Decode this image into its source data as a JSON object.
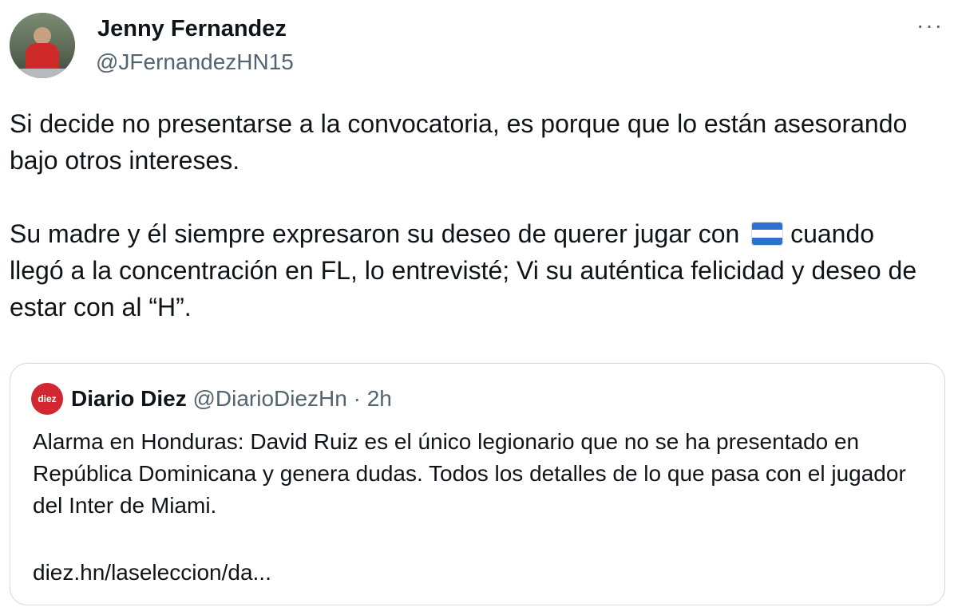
{
  "tweet": {
    "author": {
      "name": "Jenny Fernandez",
      "handle": "@JFernandezHN15"
    },
    "more_label": "···",
    "paragraphs": [
      "Si decide no presentarse a la convocatoria, es porque que lo están asesorando bajo otros intereses.",
      "Su madre y él siempre expresaron su deseo de querer jugar con",
      "cuando llegó a la concentración en FL, lo entrevisté; Vi su auténtica felicidad y deseo de estar con al “H”."
    ],
    "flag_icon": "honduras-flag-icon"
  },
  "quoted": {
    "avatar_text": "diez",
    "name": "Diario Diez",
    "meta": "@DiarioDiezHn · 2h",
    "text": "Alarma en Honduras: David Ruiz es el único legionario que no se ha presentado en República Dominicana y genera dudas. Todos los detalles de lo que pasa con el jugador del Inter de Miami.",
    "link": "diez.hn/laseleccion/da..."
  },
  "colors": {
    "text": "#0f1419",
    "secondary": "#536471",
    "border": "#cfd9de",
    "diez_red": "#d22630"
  }
}
